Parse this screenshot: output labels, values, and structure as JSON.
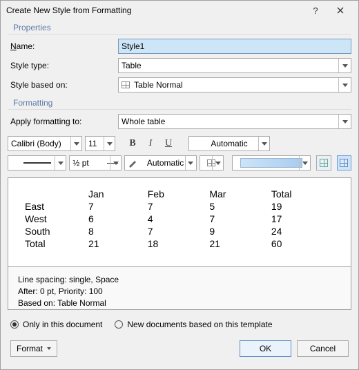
{
  "title": "Create New Style from Formatting",
  "section_properties": "Properties",
  "section_formatting": "Formatting",
  "labels": {
    "name": "Name:",
    "style_type": "Style type:",
    "style_based_on": "Style based on:",
    "apply_formatting_to": "Apply formatting to:"
  },
  "fields": {
    "name_value": "Style1",
    "style_type_value": "Table",
    "style_based_on_value": "Table Normal",
    "apply_to_value": "Whole table"
  },
  "toolbar": {
    "font": "Calibri (Body)",
    "size": "11",
    "color": "Automatic",
    "line_weight": "½ pt",
    "line_color": "Automatic"
  },
  "preview": {
    "headers": [
      "",
      "Jan",
      "Feb",
      "Mar",
      "Total"
    ],
    "rows": [
      [
        "East",
        "7",
        "7",
        "5",
        "19"
      ],
      [
        "West",
        "6",
        "4",
        "7",
        "17"
      ],
      [
        "South",
        "8",
        "7",
        "9",
        "24"
      ],
      [
        "Total",
        "21",
        "18",
        "21",
        "60"
      ]
    ]
  },
  "description": {
    "line1": "Line spacing:  single, Space",
    "line2": "After:  0 pt, Priority: 100",
    "line3": "Based on: Table Normal"
  },
  "radios": {
    "only_doc": "Only in this document",
    "new_docs": "New documents based on this template"
  },
  "buttons": {
    "format": "Format",
    "ok": "OK",
    "cancel": "Cancel"
  }
}
